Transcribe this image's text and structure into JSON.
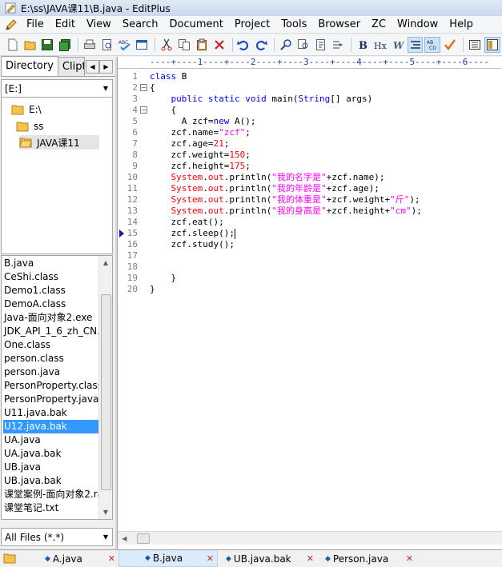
{
  "window": {
    "title": "E:\\ss\\JAVA课11\\B.java - EditPlus"
  },
  "menu": [
    "File",
    "Edit",
    "View",
    "Search",
    "Document",
    "Project",
    "Tools",
    "Browser",
    "ZC",
    "Window",
    "Help"
  ],
  "toolbar": {
    "icons": [
      "new-file-icon",
      "open-folder-icon",
      "save-icon",
      "save-all-icon",
      "print-icon",
      "print-preview-icon",
      "spell-check-icon",
      "browser-preview-icon",
      "cut-icon",
      "copy-icon",
      "paste-icon",
      "delete-icon",
      "undo-icon",
      "redo-icon",
      "find-icon",
      "replace-icon",
      "find-in-files-icon",
      "goto-icon",
      "bold-icon",
      "html-icon",
      "word-wrap-icon",
      "indent-guide-icon",
      "abcd-ruler-icon",
      "check-icon",
      "line-number-icon",
      "hex-view-icon"
    ]
  },
  "left_panel": {
    "tabs": [
      "Directory",
      "Clipt"
    ],
    "drive": "[E:]",
    "dir_tree": [
      "E:\\",
      "ss",
      "JAVA课11"
    ],
    "files": [
      "B.java",
      "CeShi.class",
      "Demo1.class",
      "DemoA.class",
      "Java-面向对象2.exe",
      "JDK_API_1_6_zh_CN.C",
      "One.class",
      "person.class",
      "person.java",
      "PersonProperty.class",
      "PersonProperty.java",
      "U11.java.bak",
      "U12.java.bak",
      "UA.java",
      "UA.java.bak",
      "UB.java",
      "UB.java.bak",
      "课堂案例-面向对象2.ra",
      "课堂笔记.txt"
    ],
    "selected_file": "U12.java.bak",
    "filter": "All Files (*.*)"
  },
  "editor": {
    "ruler": "----+----1----+----2----+----3----+----4----+----5----+----6----",
    "current_line": 15,
    "lines": [
      {
        "n": "1",
        "segs": [
          [
            "kw",
            "class"
          ],
          [
            "p",
            " B"
          ]
        ]
      },
      {
        "n": "2",
        "segs": [
          [
            "p",
            "{"
          ]
        ]
      },
      {
        "n": "3",
        "segs": [
          [
            "p",
            "    "
          ],
          [
            "kw",
            "public static void"
          ],
          [
            "p",
            " main("
          ],
          [
            "kw",
            "String"
          ],
          [
            "p",
            "[] args)"
          ]
        ]
      },
      {
        "n": "4",
        "segs": [
          [
            "p",
            "    {"
          ]
        ]
      },
      {
        "n": "5",
        "segs": [
          [
            "p",
            "      A zcf="
          ],
          [
            "kw",
            "new"
          ],
          [
            "p",
            " A();"
          ]
        ]
      },
      {
        "n": "6",
        "segs": [
          [
            "p",
            "    zcf.name="
          ],
          [
            "str",
            "\"zcf\""
          ],
          [
            "p",
            ";"
          ]
        ]
      },
      {
        "n": "7",
        "segs": [
          [
            "p",
            "    zcf.age="
          ],
          [
            "num",
            "21"
          ],
          [
            "p",
            ";"
          ]
        ]
      },
      {
        "n": "8",
        "segs": [
          [
            "p",
            "    zcf.weight="
          ],
          [
            "num",
            "150"
          ],
          [
            "p",
            ";"
          ]
        ]
      },
      {
        "n": "9",
        "segs": [
          [
            "p",
            "    zcf.height="
          ],
          [
            "num",
            "175"
          ],
          [
            "p",
            ";"
          ]
        ]
      },
      {
        "n": "10",
        "segs": [
          [
            "p",
            "    "
          ],
          [
            "sys",
            "System"
          ],
          [
            "p",
            "."
          ],
          [
            "sys",
            "out"
          ],
          [
            "p",
            ".println("
          ],
          [
            "str",
            "\"我的名字是\""
          ],
          [
            "p",
            "+zcf.name);"
          ]
        ]
      },
      {
        "n": "11",
        "segs": [
          [
            "p",
            "    "
          ],
          [
            "sys",
            "System"
          ],
          [
            "p",
            "."
          ],
          [
            "sys",
            "out"
          ],
          [
            "p",
            ".println("
          ],
          [
            "str",
            "\"我的年龄是\""
          ],
          [
            "p",
            "+zcf.age);"
          ]
        ]
      },
      {
        "n": "12",
        "segs": [
          [
            "p",
            "    "
          ],
          [
            "sys",
            "System"
          ],
          [
            "p",
            "."
          ],
          [
            "sys",
            "out"
          ],
          [
            "p",
            ".println("
          ],
          [
            "str",
            "\"我的体重是\""
          ],
          [
            "p",
            "+zcf.weight+"
          ],
          [
            "str",
            "\"斤\""
          ],
          [
            "p",
            ");"
          ]
        ]
      },
      {
        "n": "13",
        "segs": [
          [
            "p",
            "    "
          ],
          [
            "sys",
            "System"
          ],
          [
            "p",
            "."
          ],
          [
            "sys",
            "out"
          ],
          [
            "p",
            ".println("
          ],
          [
            "str",
            "\"我的身高是\""
          ],
          [
            "p",
            "+zcf.height+"
          ],
          [
            "str",
            "\"cm\""
          ],
          [
            "p",
            ");"
          ]
        ]
      },
      {
        "n": "14",
        "segs": [
          [
            "p",
            "    zcf.eat();"
          ]
        ]
      },
      {
        "n": "15",
        "segs": [
          [
            "p",
            "    zcf.sleep();"
          ],
          [
            "cursor",
            ""
          ]
        ]
      },
      {
        "n": "16",
        "segs": [
          [
            "p",
            "    zcf.study();"
          ]
        ]
      },
      {
        "n": "17",
        "segs": []
      },
      {
        "n": "18",
        "segs": []
      },
      {
        "n": "19",
        "segs": [
          [
            "p",
            "    }"
          ]
        ]
      },
      {
        "n": "20",
        "segs": [
          [
            "p",
            "}"
          ]
        ]
      }
    ]
  },
  "doc_tabs": [
    "A.java",
    "B.java",
    "UB.java.bak",
    "Person.java"
  ],
  "active_doc_tab": "B.java"
}
